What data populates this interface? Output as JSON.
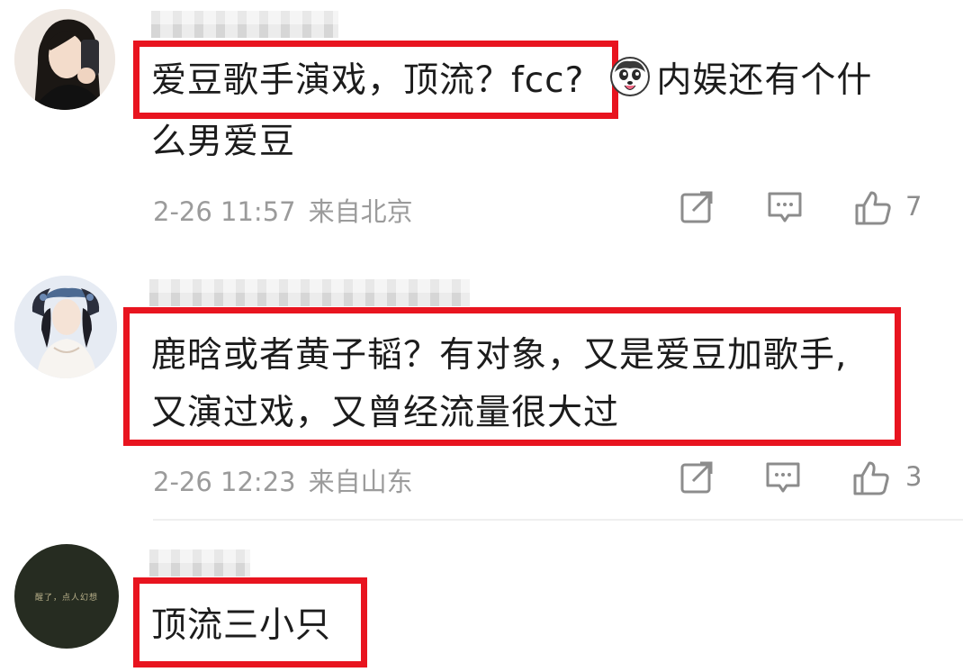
{
  "comments": [
    {
      "text_boxed": "爱豆歌手演戏，顶流？fcc?",
      "emoji": "husky-face-emoji",
      "text_rest_line1": "内娱还有个什",
      "text_line2": "么男爱豆",
      "time": "2-26 11:57",
      "location": "来自北京",
      "likes": "7",
      "avatar_style": "woman-phone-selfie"
    },
    {
      "text_line1": "鹿晗或者黄子韬？有对象，又是爱豆加歌手,",
      "text_line2": "又演过戏，又曾经流量很大过",
      "time": "2-26 12:23",
      "location": "来自山东",
      "likes": "3",
      "avatar_style": "costume-drama-woman"
    },
    {
      "text": "顶流三小只",
      "avatar_caption": "醒了，点人幻想",
      "avatar_style": "dark-green-text-avatar"
    }
  ],
  "colors": {
    "highlight_box": "#e8141f",
    "meta_text": "#9b9b9b",
    "body_text": "#1c1c1c"
  },
  "icons": [
    "share-icon",
    "comment-icon",
    "like-icon"
  ]
}
